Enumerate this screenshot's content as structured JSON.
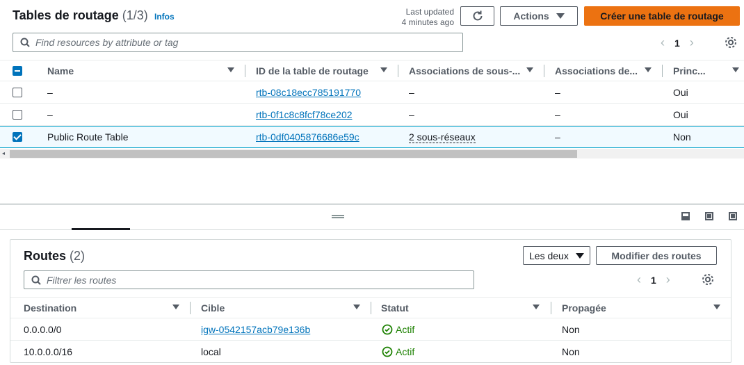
{
  "header": {
    "title": "Tables de routage",
    "count": "(1/3)",
    "info_link": "Infos",
    "last_updated_line1": "Last updated",
    "last_updated_line2": "4 minutes ago",
    "actions_label": "Actions",
    "create_label": "Créer une table de routage"
  },
  "search": {
    "placeholder": "Find resources by attribute or tag"
  },
  "pagination": {
    "page": "1"
  },
  "table": {
    "columns": [
      "Name",
      "ID de la table de routage",
      "Associations de sous-...",
      "Associations de...",
      "Princ..."
    ],
    "rows": [
      {
        "name": "–",
        "id": "rtb-08c18ecc785191770",
        "subnet_assoc": "–",
        "edge_assoc": "–",
        "main": "Oui",
        "selected": false
      },
      {
        "name": "–",
        "id": "rtb-0f1c8c8fcf78ce202",
        "subnet_assoc": "–",
        "edge_assoc": "–",
        "main": "Oui",
        "selected": false
      },
      {
        "name": "Public Route Table",
        "id": "rtb-0df0405876686e59c",
        "subnet_assoc": "2 sous-réseaux",
        "edge_assoc": "–",
        "main": "Non",
        "selected": true
      }
    ]
  },
  "routes": {
    "title": "Routes",
    "count": "(2)",
    "filter_select": "Les deux",
    "edit_label": "Modifier des routes",
    "search_placeholder": "Filtrer les routes",
    "page": "1",
    "columns": [
      "Destination",
      "Cible",
      "Statut",
      "Propagée"
    ],
    "rows": [
      {
        "destination": "0.0.0.0/0",
        "target": "igw-0542157acb79e136b",
        "status": "Actif",
        "propagated": "Non"
      },
      {
        "destination": "10.0.0.0/16",
        "target": "local",
        "status": "Actif",
        "propagated": "Non"
      }
    ]
  },
  "colors": {
    "accent": "#ec7211",
    "link": "#0073bb",
    "success": "#1d8102"
  }
}
